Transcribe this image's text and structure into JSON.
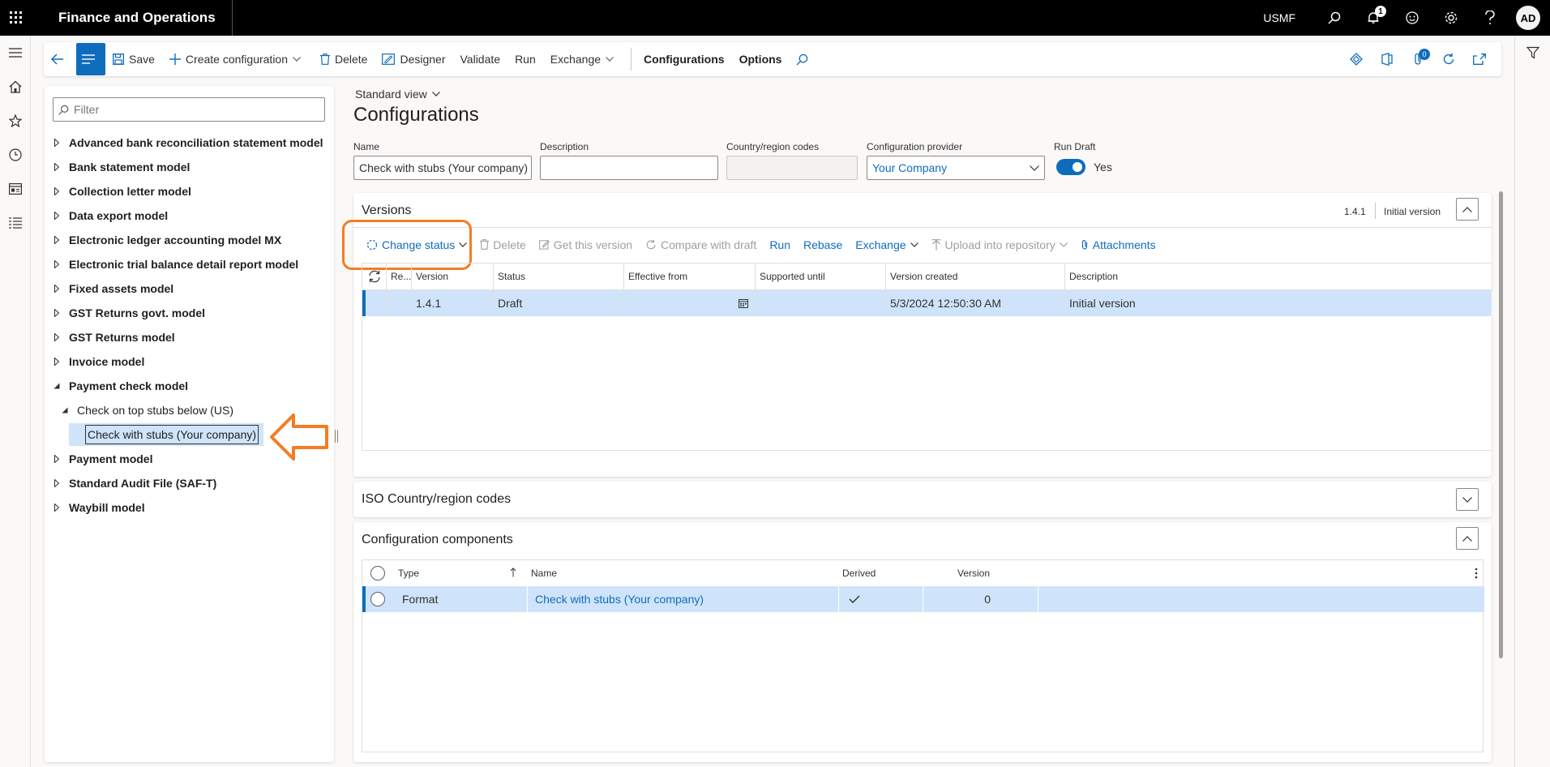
{
  "app": {
    "title": "Finance and Operations",
    "company": "USMF",
    "notifications": "1",
    "avatar": "AD"
  },
  "actionpane": {
    "save": "Save",
    "create_configuration": "Create configuration",
    "delete": "Delete",
    "designer": "Designer",
    "validate": "Validate",
    "run": "Run",
    "exchange": "Exchange",
    "configurations": "Configurations",
    "options": "Options",
    "badge": "0"
  },
  "tree": {
    "filter_placeholder": "Filter",
    "items": [
      {
        "label": "Advanced bank reconciliation statement model"
      },
      {
        "label": "Bank statement model"
      },
      {
        "label": "Collection letter model"
      },
      {
        "label": "Data export model"
      },
      {
        "label": "Electronic ledger accounting model MX"
      },
      {
        "label": "Electronic trial balance detail report model"
      },
      {
        "label": "Fixed assets model"
      },
      {
        "label": "GST Returns govt. model"
      },
      {
        "label": "GST Returns model"
      },
      {
        "label": "Invoice model"
      },
      {
        "label": "Payment check model"
      },
      {
        "label": "Check on top stubs below (US)"
      },
      {
        "label": "Check with stubs (Your company)"
      },
      {
        "label": "Payment model"
      },
      {
        "label": "Standard Audit File (SAF-T)"
      },
      {
        "label": "Waybill model"
      }
    ]
  },
  "page": {
    "view": "Standard view",
    "title": "Configurations",
    "fields": {
      "name_label": "Name",
      "name_value": "Check with stubs (Your company)",
      "description_label": "Description",
      "description_value": "",
      "country_label": "Country/region codes",
      "provider_label": "Configuration provider",
      "provider_value": "Your Company",
      "rundraft_label": "Run Draft",
      "rundraft_value": "Yes"
    }
  },
  "versions": {
    "title": "Versions",
    "current_version": "1.4.1",
    "current_desc": "Initial version",
    "toolbar": {
      "change_status": "Change status",
      "delete": "Delete",
      "get_version": "Get this version",
      "compare": "Compare with draft",
      "run": "Run",
      "rebase": "Rebase",
      "exchange": "Exchange",
      "upload": "Upload into repository",
      "attachments": "Attachments"
    },
    "columns": [
      "Re...",
      "Version",
      "Status",
      "Effective from",
      "Supported until",
      "Version created",
      "Description"
    ],
    "rows": [
      {
        "version": "1.4.1",
        "status": "Draft",
        "effective": "",
        "supported": "",
        "created": "5/3/2024 12:50:30 AM",
        "description": "Initial version"
      }
    ]
  },
  "iso": {
    "title": "ISO Country/region codes"
  },
  "components": {
    "title": "Configuration components",
    "columns": [
      "Type",
      "Name",
      "Derived",
      "Version"
    ],
    "rows": [
      {
        "type": "Format",
        "name": "Check with stubs (Your company)",
        "derived": true,
        "version": "0"
      }
    ]
  },
  "colors": {
    "accent": "#0f6cbd",
    "highlight": "#f57c23",
    "selected_row": "#cfe4fa"
  }
}
